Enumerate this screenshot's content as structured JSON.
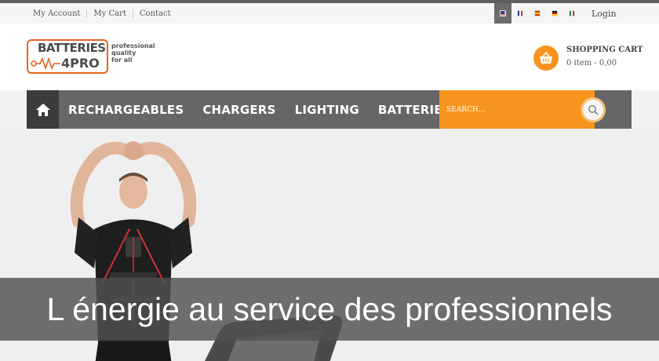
{
  "topbar": {
    "links": [
      "My Account",
      "My Cart",
      "Contact"
    ],
    "languages": [
      "us-flag-icon",
      "fr-flag-icon",
      "es-flag-icon",
      "de-flag-icon",
      "it-flag-icon"
    ],
    "active_language": "us-flag-icon",
    "login": "Login"
  },
  "logo": {
    "line1": "BATTERIES",
    "line2": "4PRO",
    "tagline": [
      "professional",
      "quality",
      "for all"
    ]
  },
  "cart": {
    "title": "SHOPPING CART",
    "info": "0 item - 0,00",
    "icon": "basket-icon",
    "accent_color": "#f7941d"
  },
  "nav": {
    "home_icon": "home-icon",
    "items": [
      "RECHARGEABLES",
      "CHARGERS",
      "LIGHTING",
      "BATTERIES"
    ],
    "background_color": "#666666",
    "search_placeholder": "SEARCH...",
    "search_icon": "magnifier-icon"
  },
  "hero": {
    "banner_text": "L énergie au service des professionnels"
  }
}
